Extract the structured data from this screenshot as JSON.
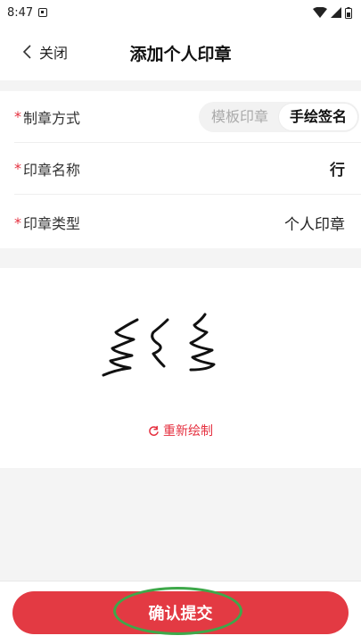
{
  "status_bar": {
    "time": "8:47"
  },
  "header": {
    "back_label": "关闭",
    "title": "添加个人印章"
  },
  "form": {
    "method": {
      "label": "制章方式",
      "options": [
        "模板印章",
        "手绘签名"
      ],
      "selected": "手绘签名"
    },
    "name": {
      "label": "印章名称",
      "value": "行"
    },
    "type": {
      "label": "印章类型",
      "value": "个人印章"
    },
    "required_mark": "*"
  },
  "signature": {
    "redraw_label": "重新绘制"
  },
  "footer": {
    "submit_label": "确认提交"
  },
  "colors": {
    "accent": "#e33a43",
    "highlight": "#3ea84a"
  }
}
